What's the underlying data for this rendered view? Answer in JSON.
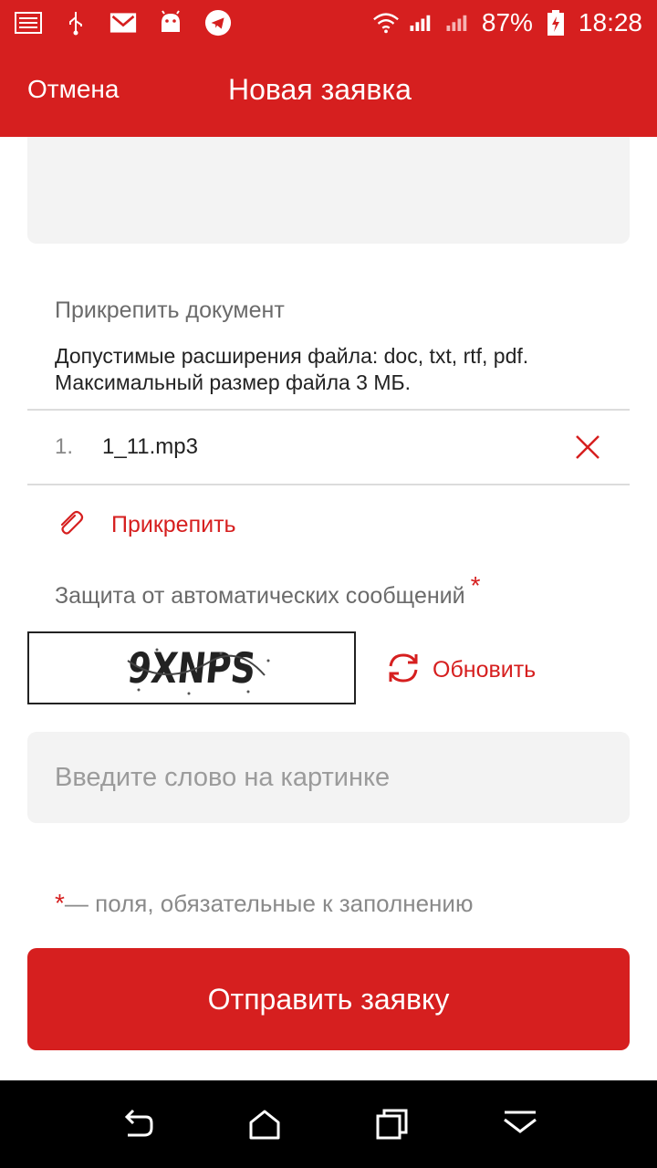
{
  "status_bar": {
    "battery": "87%",
    "time": "18:28",
    "icons": [
      "picture-icon",
      "usb-icon",
      "gmail-icon",
      "android-icon",
      "telegram-icon",
      "wifi-icon",
      "signal-icon",
      "signal2-icon",
      "battery-icon"
    ]
  },
  "app_bar": {
    "cancel_label": "Отмена",
    "title": "Новая заявка"
  },
  "attachment": {
    "heading": "Прикрепить документ",
    "hint_line1": "Допустимые расширения файла: doc, txt, rtf, pdf.",
    "hint_line2": "Максимальный размер файла 3 МБ.",
    "files": [
      {
        "number": "1.",
        "name": "1_11.mp3"
      }
    ],
    "attach_label": "Прикрепить"
  },
  "captcha": {
    "heading": "Защита от автоматических сообщений",
    "required_mark": "*",
    "image_text": "9XNPS",
    "refresh_label": "Обновить",
    "input_value": "",
    "input_placeholder": "Введите слово на картинке"
  },
  "required_note": {
    "star": "*",
    "text": "— поля, обязательные к заполнению"
  },
  "submit_label": "Отправить заявку",
  "colors": {
    "brand_red": "#d61f1f",
    "field_bg": "#f3f3f3",
    "muted_text": "#6b6b6b"
  }
}
